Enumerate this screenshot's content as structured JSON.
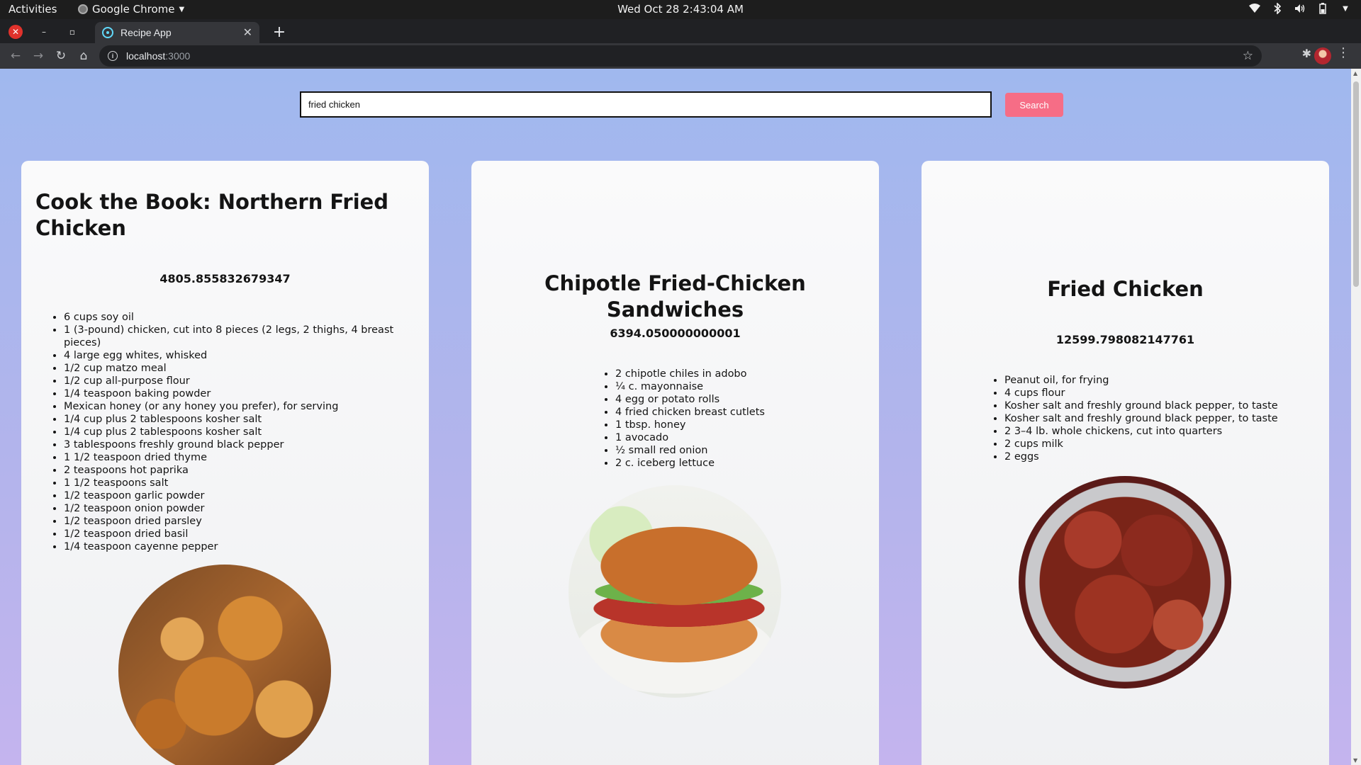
{
  "os": {
    "activities": "Activities",
    "app_name": "Google Chrome",
    "clock": "Wed Oct 28   2:43:04 AM"
  },
  "browser": {
    "tab_title": "Recipe App",
    "tab_close": "✕",
    "new_tab": "+",
    "url_host": "localhost",
    "url_port": ":3000"
  },
  "search": {
    "value": "fried chicken",
    "button_label": "Search"
  },
  "recipes": [
    {
      "title": "Cook the Book: Northern Fried Chicken",
      "calories": "4805.855832679347",
      "ingredients": [
        "6 cups soy oil",
        "1 (3-pound) chicken, cut into 8 pieces (2 legs, 2 thighs, 4 breast pieces)",
        "4 large egg whites, whisked",
        "1/2 cup matzo meal",
        "1/2 cup all-purpose flour",
        "1/4 teaspoon baking powder",
        "Mexican honey (or any honey you prefer), for serving",
        "1/4 cup plus 2 tablespoons kosher salt",
        "1/4 cup plus 2 tablespoons kosher salt",
        "3 tablespoons freshly ground black pepper",
        "1 1/2 teaspoon dried thyme",
        "2 teaspoons hot paprika",
        "1 1/2 teaspoons salt",
        "1/2 teaspoon garlic powder",
        "1/2 teaspoon onion powder",
        "1/2 teaspoon dried parsley",
        "1/2 teaspoon dried basil",
        "1/4 teaspoon cayenne pepper"
      ]
    },
    {
      "title": "Chipotle Fried-Chicken Sandwiches",
      "calories": "6394.050000000001",
      "ingredients": [
        "2 chipotle chiles in adobo",
        "¼ c. mayonnaise",
        "4 egg or potato rolls",
        "4 fried chicken breast cutlets",
        "1 tbsp. honey",
        "1 avocado",
        "½ small red onion",
        "2 c. iceberg lettuce"
      ]
    },
    {
      "title": "Fried Chicken",
      "calories": "12599.798082147761",
      "ingredients": [
        "Peanut oil, for frying",
        "4 cups flour",
        "Kosher salt and freshly ground black pepper, to taste",
        "Kosher salt and freshly ground black pepper, to taste",
        "2 3–4 lb. whole chickens, cut into quarters",
        "2 cups milk",
        "2 eggs"
      ]
    }
  ]
}
